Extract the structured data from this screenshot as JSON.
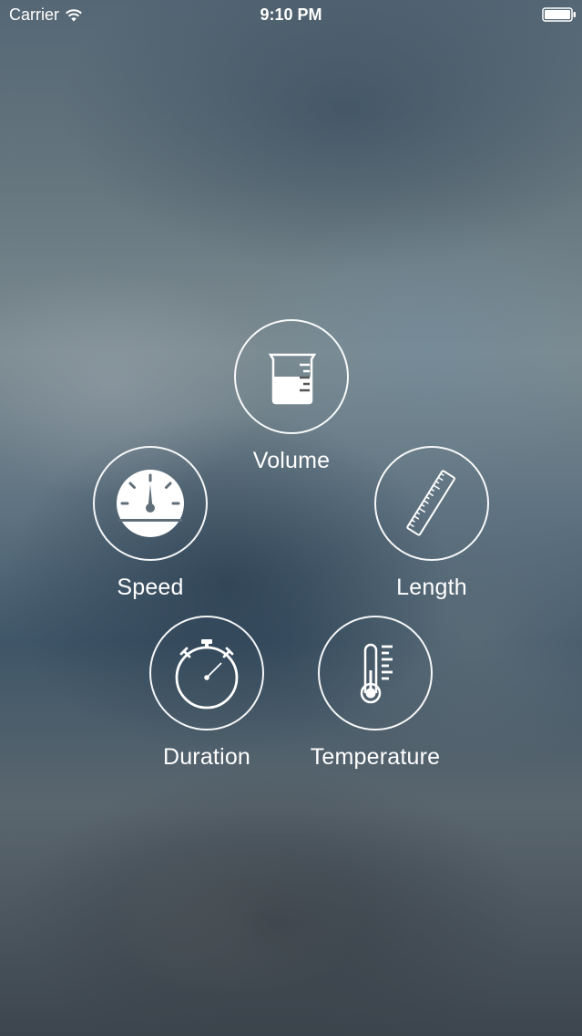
{
  "status_bar": {
    "carrier": "Carrier",
    "time": "9:10 PM",
    "icons": [
      "wifi-icon",
      "battery-icon"
    ]
  },
  "menu": {
    "items": [
      {
        "label": "Volume",
        "icon": "beaker-icon"
      },
      {
        "label": "Speed",
        "icon": "speedometer-icon"
      },
      {
        "label": "Length",
        "icon": "ruler-icon"
      },
      {
        "label": "Duration",
        "icon": "stopwatch-icon"
      },
      {
        "label": "Temperature",
        "icon": "thermometer-icon"
      }
    ]
  },
  "colors": {
    "foreground": "#ffffff",
    "background_blur_tones": [
      "#556775",
      "#7c8b91",
      "#3f5668",
      "#3c454d"
    ]
  }
}
